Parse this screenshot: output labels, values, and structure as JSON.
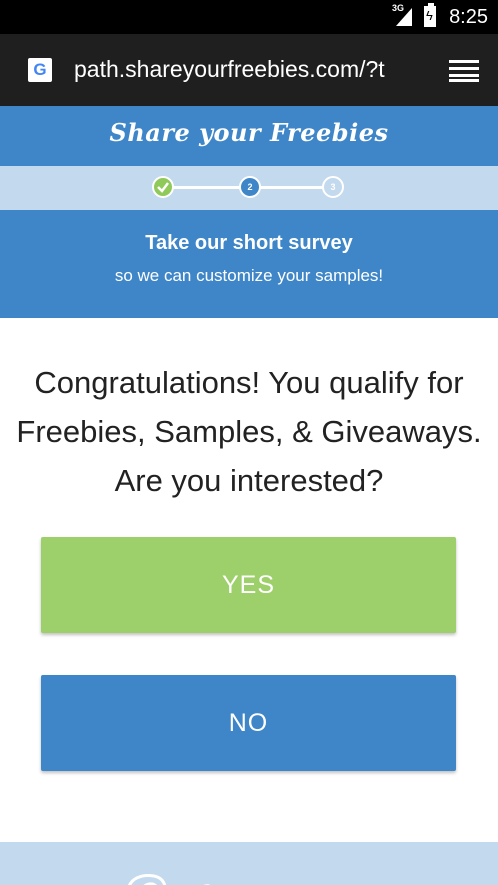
{
  "status_bar": {
    "network": "3G",
    "time": "8:25"
  },
  "browser": {
    "url": "path.shareyourfreebies.com/?t",
    "site_icon": "google-icon",
    "menu_icon": "tabs-switcher-icon"
  },
  "header": {
    "brand": "Share your Freebies"
  },
  "progress": {
    "steps": [
      {
        "label": "",
        "state": "done"
      },
      {
        "label": "2",
        "state": "current"
      },
      {
        "label": "3",
        "state": "pending"
      }
    ]
  },
  "survey": {
    "title": "Take our short survey",
    "subtitle": "so we can customize your samples!"
  },
  "question": {
    "lines": [
      "Congratulations! You qualify for",
      "Freebies, Samples, & Giveaways.",
      "Are you interested?"
    ]
  },
  "answers": {
    "yes": "YES",
    "no": "NO"
  },
  "colors": {
    "brand_blue": "#3e86c8",
    "light_blue": "#c3d9ee",
    "green": "#9dcf6a"
  }
}
